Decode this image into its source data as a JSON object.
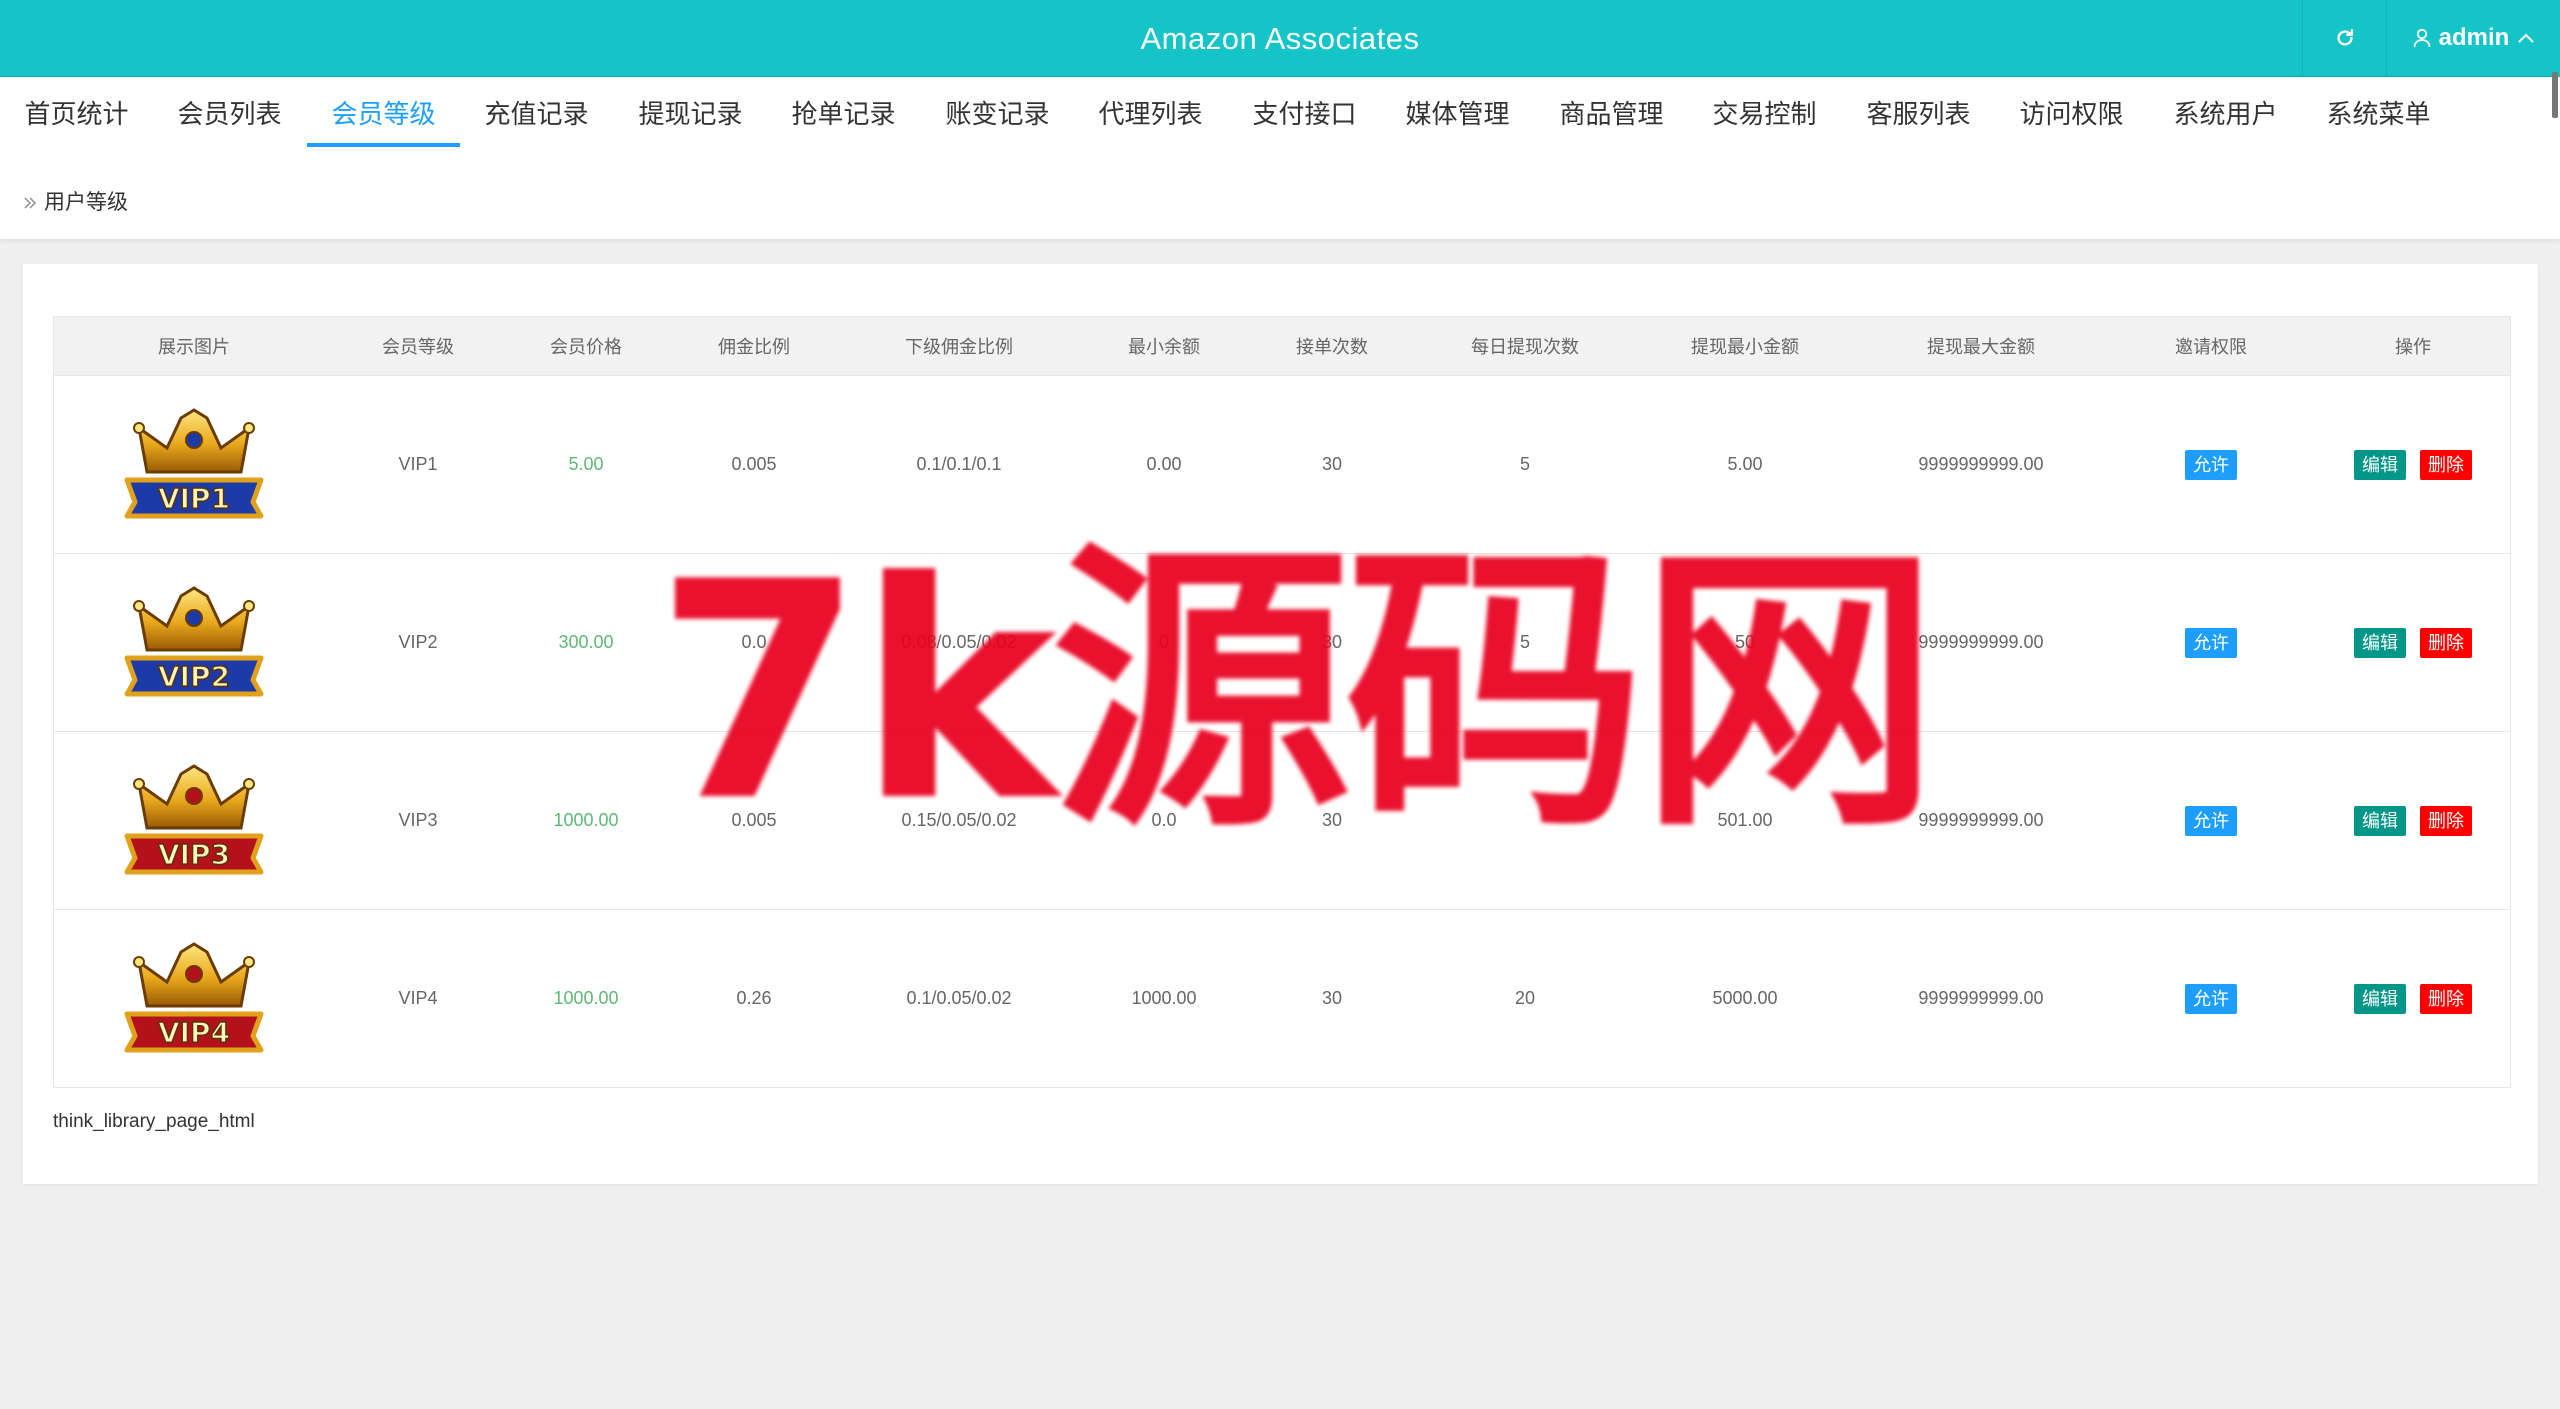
{
  "header": {
    "title": "Amazon Associates",
    "user": "admin",
    "refresh_icon": "refresh-icon",
    "user_icon": "user-icon",
    "chevron_icon": "chevron-up-icon",
    "bg_color": "#15c4c6"
  },
  "nav": {
    "active_index": 2,
    "accent_color": "#1e9fff",
    "tabs": [
      "首页统计",
      "会员列表",
      "会员等级",
      "充值记录",
      "提现记录",
      "抢单记录",
      "账变记录",
      "代理列表",
      "支付接口",
      "媒体管理",
      "商品管理",
      "交易控制",
      "客服列表",
      "访问权限",
      "系统用户",
      "系统菜单"
    ]
  },
  "breadcrumb": {
    "icon": "double-chevron-right-icon",
    "label": "用户等级"
  },
  "table": {
    "headers": [
      "展示图片",
      "会员等级",
      "会员价格",
      "佣金比例",
      "下级佣金比例",
      "最小余额",
      "接单次数",
      "每日提现次数",
      "提现最小金额",
      "提现最大金额",
      "邀请权限",
      "操作"
    ],
    "rows": [
      {
        "badge_text": "VIP1",
        "badge_color": "#1c3aa8",
        "level": "VIP1",
        "price": "5.00",
        "commission": "0.005",
        "sub_commission": "0.1/0.1/0.1",
        "min_balance": "0.00",
        "orders": "30",
        "daily_withdrawals": "5",
        "withdraw_min": "5.00",
        "withdraw_max": "9999999999.00",
        "invite": "允许",
        "edit": "编辑",
        "delete": "删除"
      },
      {
        "badge_text": "VIP2",
        "badge_color": "#1c3aa8",
        "level": "VIP2",
        "price": "300.00",
        "commission": "0.0",
        "sub_commission": "0.08/0.05/0.02",
        "min_balance": "0",
        "orders": "30",
        "daily_withdrawals": "5",
        "withdraw_min": "50",
        "withdraw_max": "9999999999.00",
        "invite": "允许",
        "edit": "编辑",
        "delete": "删除"
      },
      {
        "badge_text": "VIP3",
        "badge_color": "#b3121c",
        "level": "VIP3",
        "price": "1000.00",
        "commission": "0.005",
        "sub_commission": "0.15/0.05/0.02",
        "min_balance": "0.0",
        "orders": "30",
        "daily_withdrawals": "",
        "withdraw_min": "501.00",
        "withdraw_max": "9999999999.00",
        "invite": "允许",
        "edit": "编辑",
        "delete": "删除"
      },
      {
        "badge_text": "VIP4",
        "badge_color": "#b3121c",
        "level": "VIP4",
        "price": "1000.00",
        "commission": "0.26",
        "sub_commission": "0.1/0.05/0.02",
        "min_balance": "1000.00",
        "orders": "30",
        "daily_withdrawals": "20",
        "withdraw_min": "5000.00",
        "withdraw_max": "9999999999.00",
        "invite": "允许",
        "edit": "编辑",
        "delete": "删除"
      }
    ]
  },
  "pager_text": "think_library_page_html",
  "watermark": "7k源码网"
}
